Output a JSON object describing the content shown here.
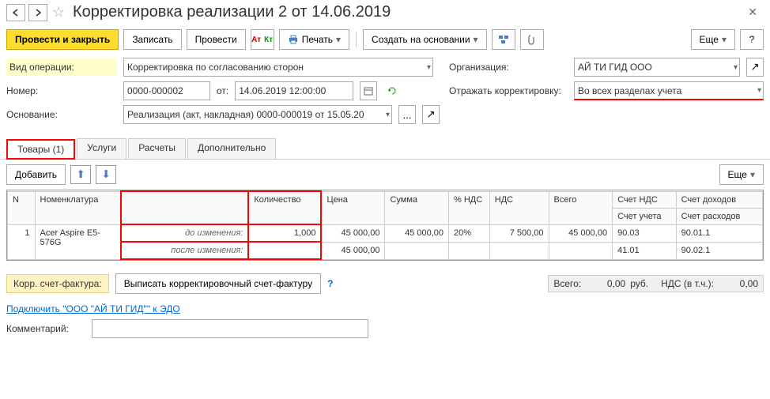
{
  "header": {
    "title": "Корректировка реализации 2 от 14.06.2019"
  },
  "toolbar": {
    "post_close": "Провести и закрыть",
    "write": "Записать",
    "post": "Провести",
    "print": "Печать",
    "create_based": "Создать на основании",
    "more": "Еще"
  },
  "form": {
    "op_type_label": "Вид операции:",
    "op_type_value": "Корректировка по согласованию сторон",
    "org_label": "Организация:",
    "org_value": "АЙ ТИ ГИД ООО",
    "number_label": "Номер:",
    "number_value": "0000-000002",
    "from_label": "от:",
    "date_value": "14.06.2019 12:00:00",
    "reflect_label": "Отражать корректировку:",
    "reflect_value": "Во всех разделах учета",
    "basis_label": "Основание:",
    "basis_value": "Реализация (акт, накладная) 0000-000019 от 15.05.20"
  },
  "tabs": {
    "goods": "Товары (1)",
    "services": "Услуги",
    "calc": "Расчеты",
    "extra": "Дополнительно"
  },
  "table_toolbar": {
    "add": "Добавить",
    "more": "Еще"
  },
  "table": {
    "headers": {
      "n": "N",
      "item": "Номенклатура",
      "change": "",
      "qty": "Количество",
      "price": "Цена",
      "sum": "Сумма",
      "vat_pct": "% НДС",
      "vat": "НДС",
      "total": "Всего",
      "vat_acc": "Счет НДС",
      "acc": "Счет учета",
      "income_acc": "Счет доходов",
      "expense_acc": "Счет расходов"
    },
    "rows": [
      {
        "n": "1",
        "item": "Acer Aspire E5-576G",
        "before_label": "до изменения:",
        "after_label": "после изменения:",
        "qty_before": "1,000",
        "price_before": "45 000,00",
        "price_after": "45 000,00",
        "sum_before": "45 000,00",
        "vat_pct": "20%",
        "vat_before": "7 500,00",
        "total_before": "45 000,00",
        "vat_acc": "90.03",
        "acc": "41.01",
        "income_acc": "90.01.1",
        "expense_acc": "90.02.1"
      }
    ]
  },
  "footer": {
    "corr_invoice_label": "Корр. счет-фактура:",
    "corr_invoice_btn": "Выписать корректировочный счет-фактуру",
    "total_label": "Всего:",
    "total_value": "0,00",
    "currency": "руб.",
    "vat_label": "НДС (в т.ч.):",
    "vat_value": "0,00",
    "edo_link": "Подключить \"ООО \"АЙ ТИ ГИД\"\" к ЭДО",
    "comment_label": "Комментарий:"
  }
}
